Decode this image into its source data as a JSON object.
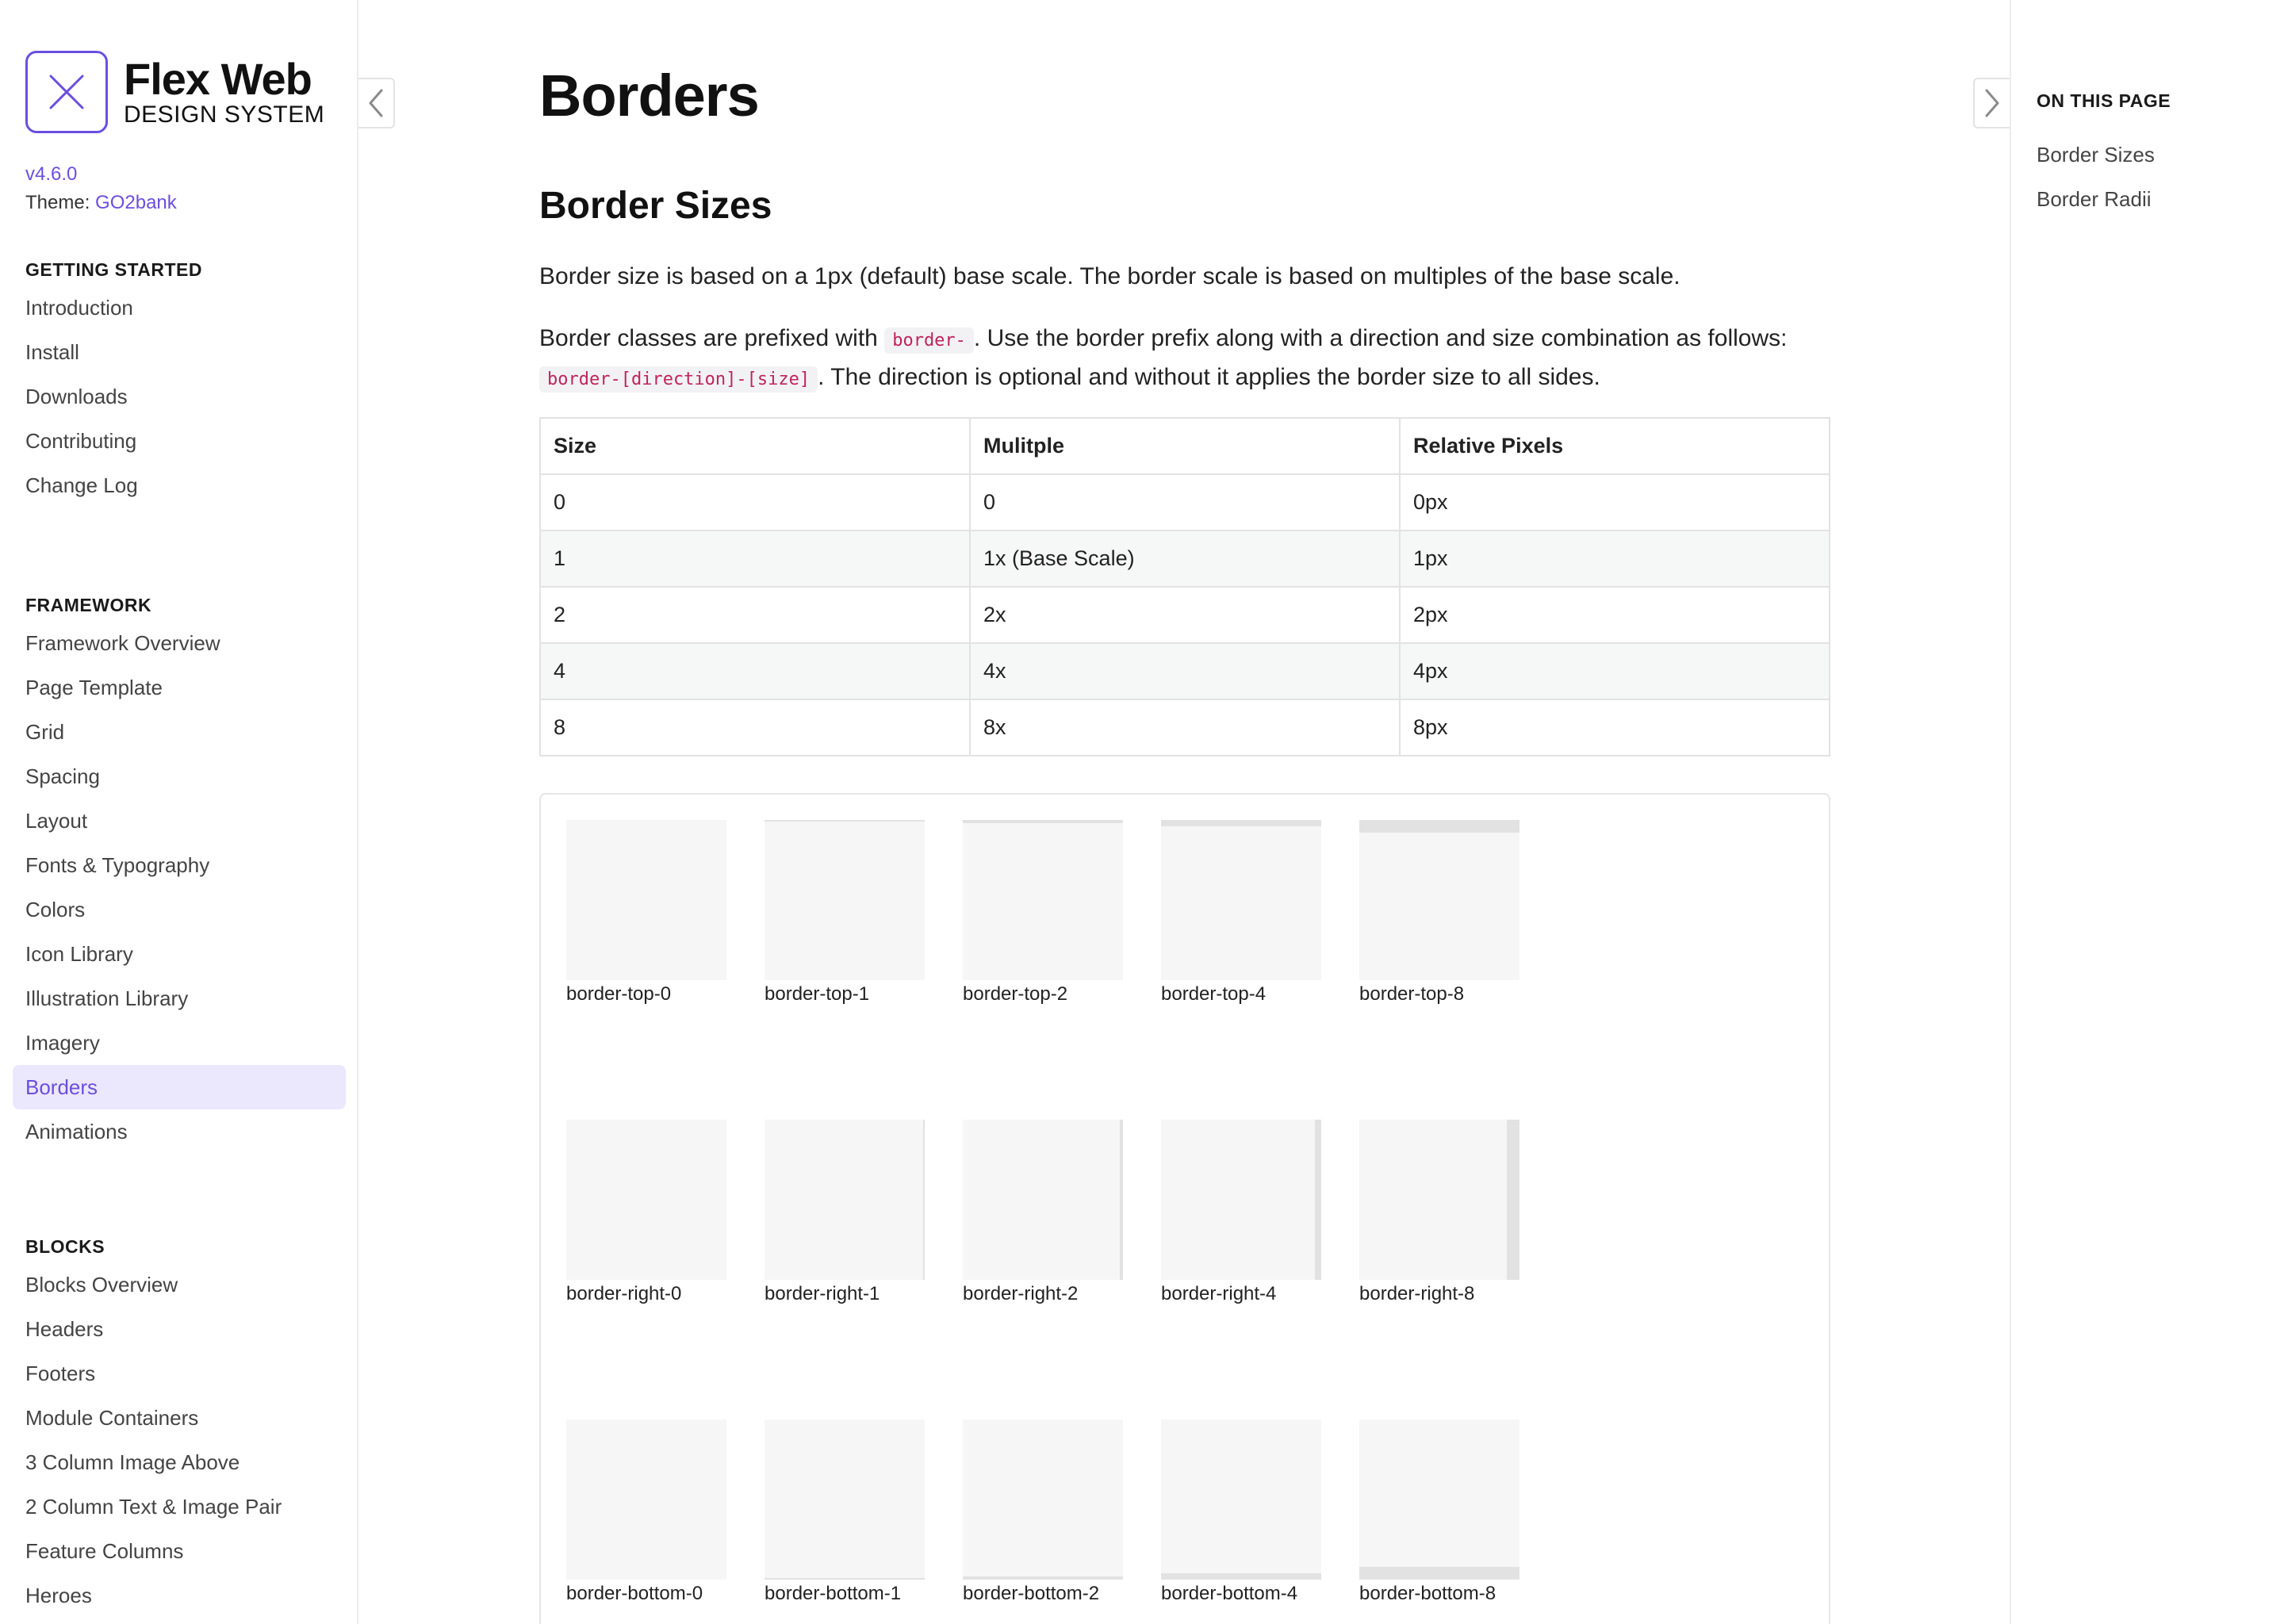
{
  "brand": {
    "title": "Flex Web",
    "subtitle": "DESIGN SYSTEM",
    "version": "v4.6.0",
    "theme_label": "Theme:",
    "theme_value": "GO2bank",
    "accent_color": "#6a4fe0"
  },
  "sidebar": {
    "sections": [
      {
        "heading": "GETTING STARTED",
        "items": [
          "Introduction",
          "Install",
          "Downloads",
          "Contributing",
          "Change Log"
        ]
      },
      {
        "heading": "FRAMEWORK",
        "items": [
          "Framework Overview",
          "Page Template",
          "Grid",
          "Spacing",
          "Layout",
          "Fonts & Typography",
          "Colors",
          "Icon Library",
          "Illustration Library",
          "Imagery",
          "Borders",
          "Animations"
        ],
        "active": "Borders"
      },
      {
        "heading": "BLOCKS",
        "items": [
          "Blocks Overview",
          "Headers",
          "Footers",
          "Module Containers",
          "3 Column Image Above",
          "2 Column Text & Image Pair",
          "Feature Columns",
          "Heroes"
        ]
      }
    ]
  },
  "on_this_page": {
    "heading": "ON THIS PAGE",
    "links": [
      "Border Sizes",
      "Border Radii"
    ]
  },
  "main": {
    "title": "Borders",
    "section_title": "Border Sizes",
    "intro": "Border size is based on a 1px (default) base scale. The border scale is based on multiples of the base scale.",
    "prefix_text_1": "Border classes are prefixed with ",
    "prefix_code": "border-",
    "prefix_text_2": ". Use the border prefix along with a direction and size combination as follows: ",
    "pattern_code": "border-[direction]-[size]",
    "prefix_text_3": ". The direction is optional and without it applies the border size to all sides.",
    "table": {
      "headers": [
        "Size",
        "Mulitple",
        "Relative Pixels"
      ],
      "rows": [
        [
          "0",
          "0",
          "0px"
        ],
        [
          "1",
          "1x (Base Scale)",
          "1px"
        ],
        [
          "2",
          "2x",
          "2px"
        ],
        [
          "4",
          "4x",
          "4px"
        ],
        [
          "8",
          "8x",
          "8px"
        ]
      ]
    },
    "swatches": {
      "top": [
        "border-top-0",
        "border-top-1",
        "border-top-2",
        "border-top-4",
        "border-top-8"
      ],
      "right": [
        "border-right-0",
        "border-right-1",
        "border-right-2",
        "border-right-4",
        "border-right-8"
      ],
      "bottom": [
        "border-bottom-0",
        "border-bottom-1",
        "border-bottom-2",
        "border-bottom-4",
        "border-bottom-8"
      ]
    }
  },
  "icons": {
    "logo": "close-x-icon",
    "prev": "chevron-left-icon",
    "next": "chevron-right-icon"
  }
}
